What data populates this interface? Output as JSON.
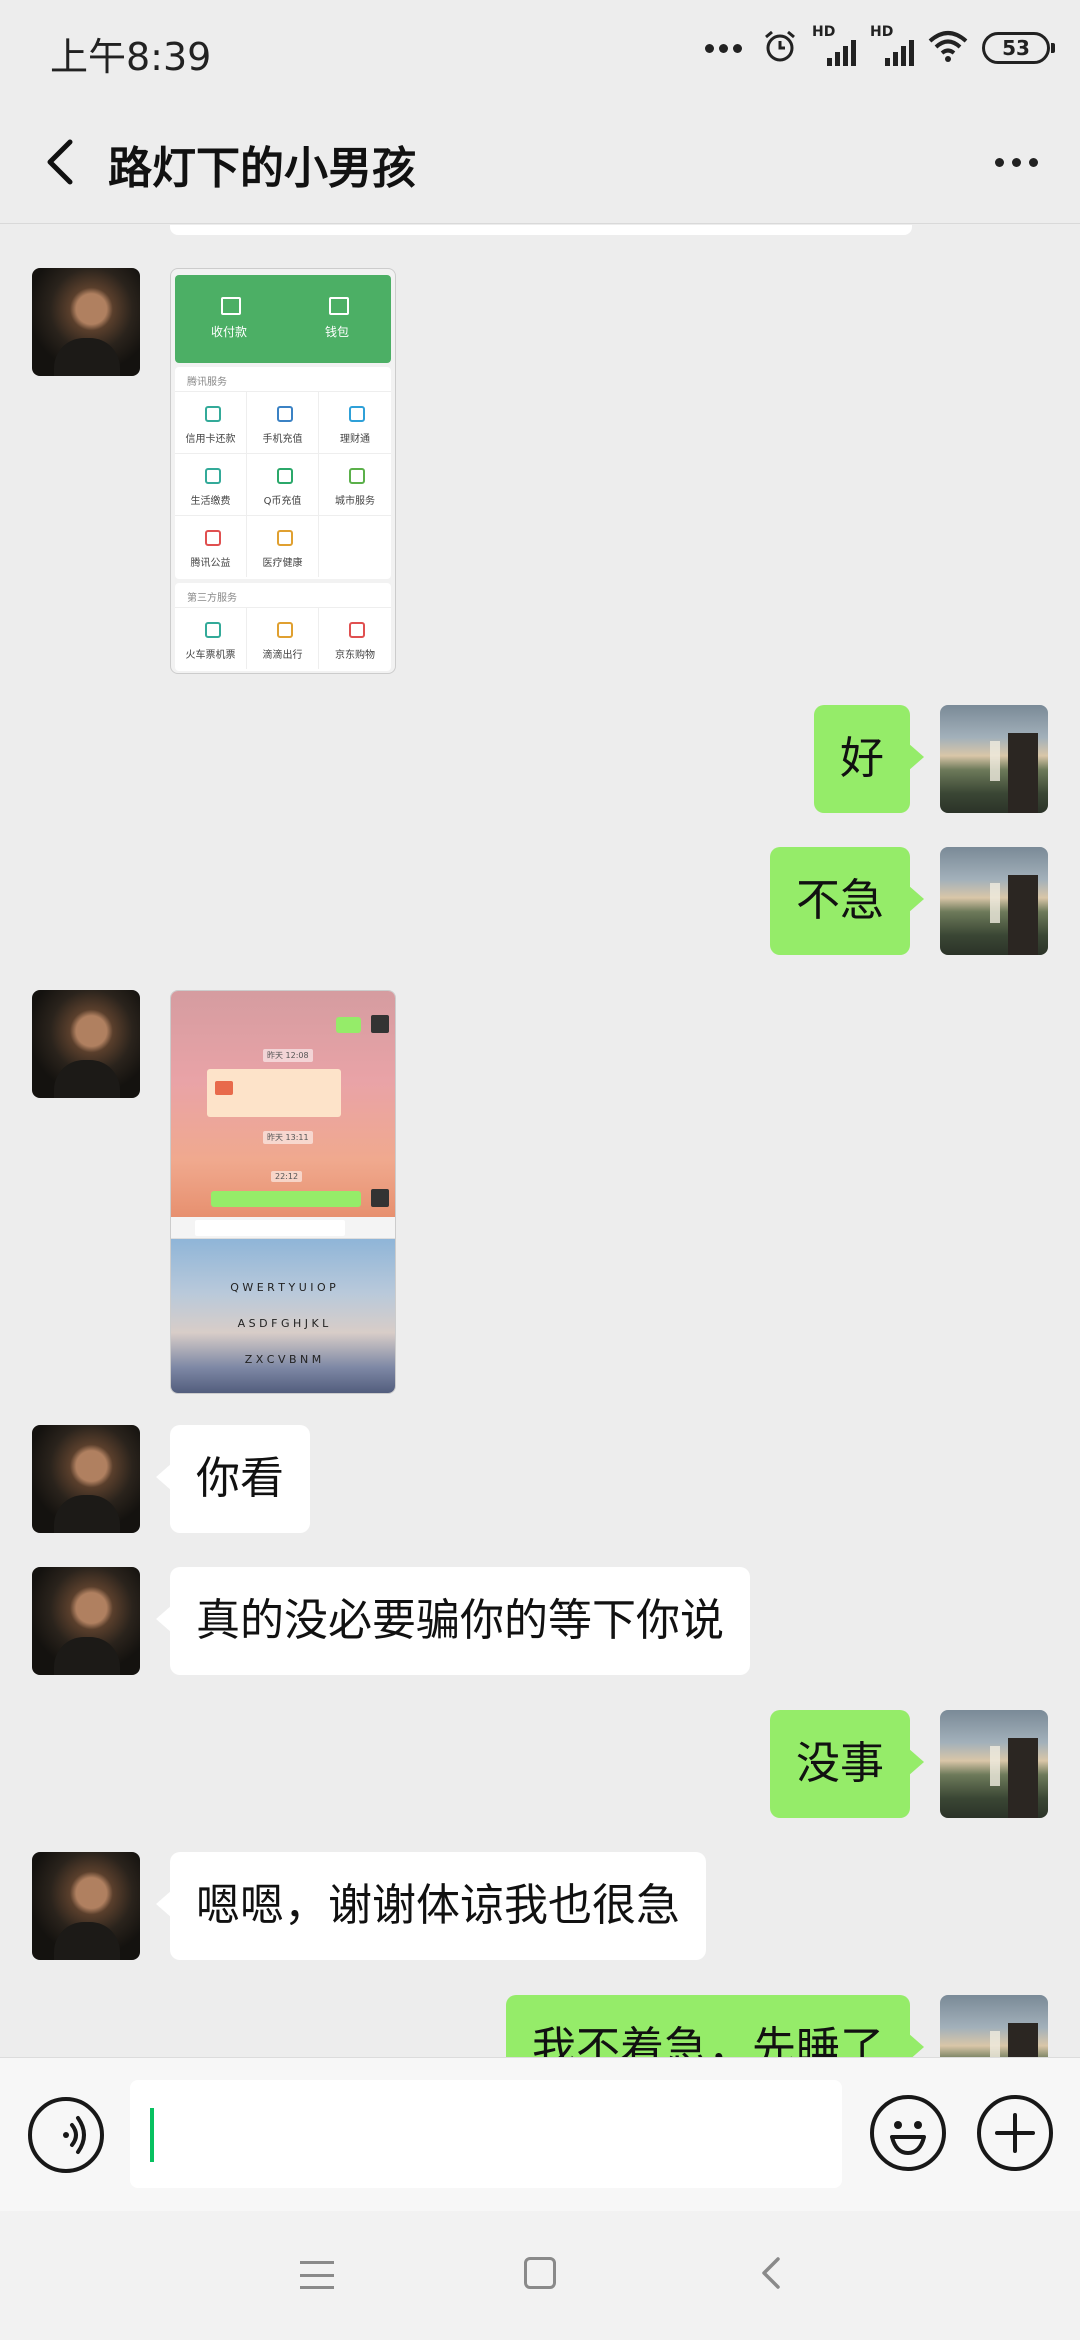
{
  "status_bar": {
    "time": "上午8:39",
    "signal_labels": [
      "HD",
      "HD"
    ],
    "battery": "53",
    "icons": [
      "more-dots-icon",
      "alarm-icon",
      "signal-icon",
      "signal-icon",
      "wifi-icon",
      "battery-icon"
    ]
  },
  "header": {
    "title": "路灯下的小男孩",
    "back_icon": "chevron-left-icon",
    "more_icon": "more-icon"
  },
  "messages": [
    {
      "side": "left",
      "type": "image",
      "content": "wallet-screenshot"
    },
    {
      "side": "right",
      "type": "text",
      "text": "好"
    },
    {
      "side": "right",
      "type": "text",
      "text": "不急"
    },
    {
      "side": "left",
      "type": "image",
      "content": "chat-screenshot"
    },
    {
      "side": "left",
      "type": "text",
      "text": "你看"
    },
    {
      "side": "left",
      "type": "text",
      "text": "真的没必要骗你的等下你说"
    },
    {
      "side": "right",
      "type": "text",
      "text": "没事"
    },
    {
      "side": "left",
      "type": "text",
      "text": "嗯嗯，谢谢体谅我也很急"
    },
    {
      "side": "right",
      "type": "text",
      "text": "我不着急，先睡了"
    }
  ],
  "wallet_screenshot": {
    "top_items": [
      "收付款",
      "钱包"
    ],
    "section1_title": "腾讯服务",
    "section1_items": [
      "信用卡还款",
      "手机充值",
      "理财通",
      "生活缴费",
      "Q币充值",
      "城市服务",
      "腾讯公益",
      "医疗健康"
    ],
    "section2_title": "第三方服务",
    "section2_items": [
      "火车票机票",
      "滴滴出行",
      "京东购物"
    ]
  },
  "chat_screenshot": {
    "time1": "昨天 12:08",
    "time2": "昨天 13:11",
    "time3": "22:12",
    "keyboard_row1": "Q W E R T Y U I O P",
    "keyboard_row2": "A S D F G H J K L",
    "keyboard_row3": "Z X C V B N M"
  },
  "input_bar": {
    "voice_icon": "voice-icon",
    "emoji_icon": "emoji-icon",
    "plus_icon": "plus-icon",
    "value": ""
  },
  "system_nav": {
    "icons": [
      "menu-icon",
      "home-icon",
      "back-icon"
    ]
  },
  "colors": {
    "background": "#ededed",
    "bubble_sent": "#95ec69",
    "bubble_received": "#ffffff",
    "cursor": "#07c160"
  }
}
